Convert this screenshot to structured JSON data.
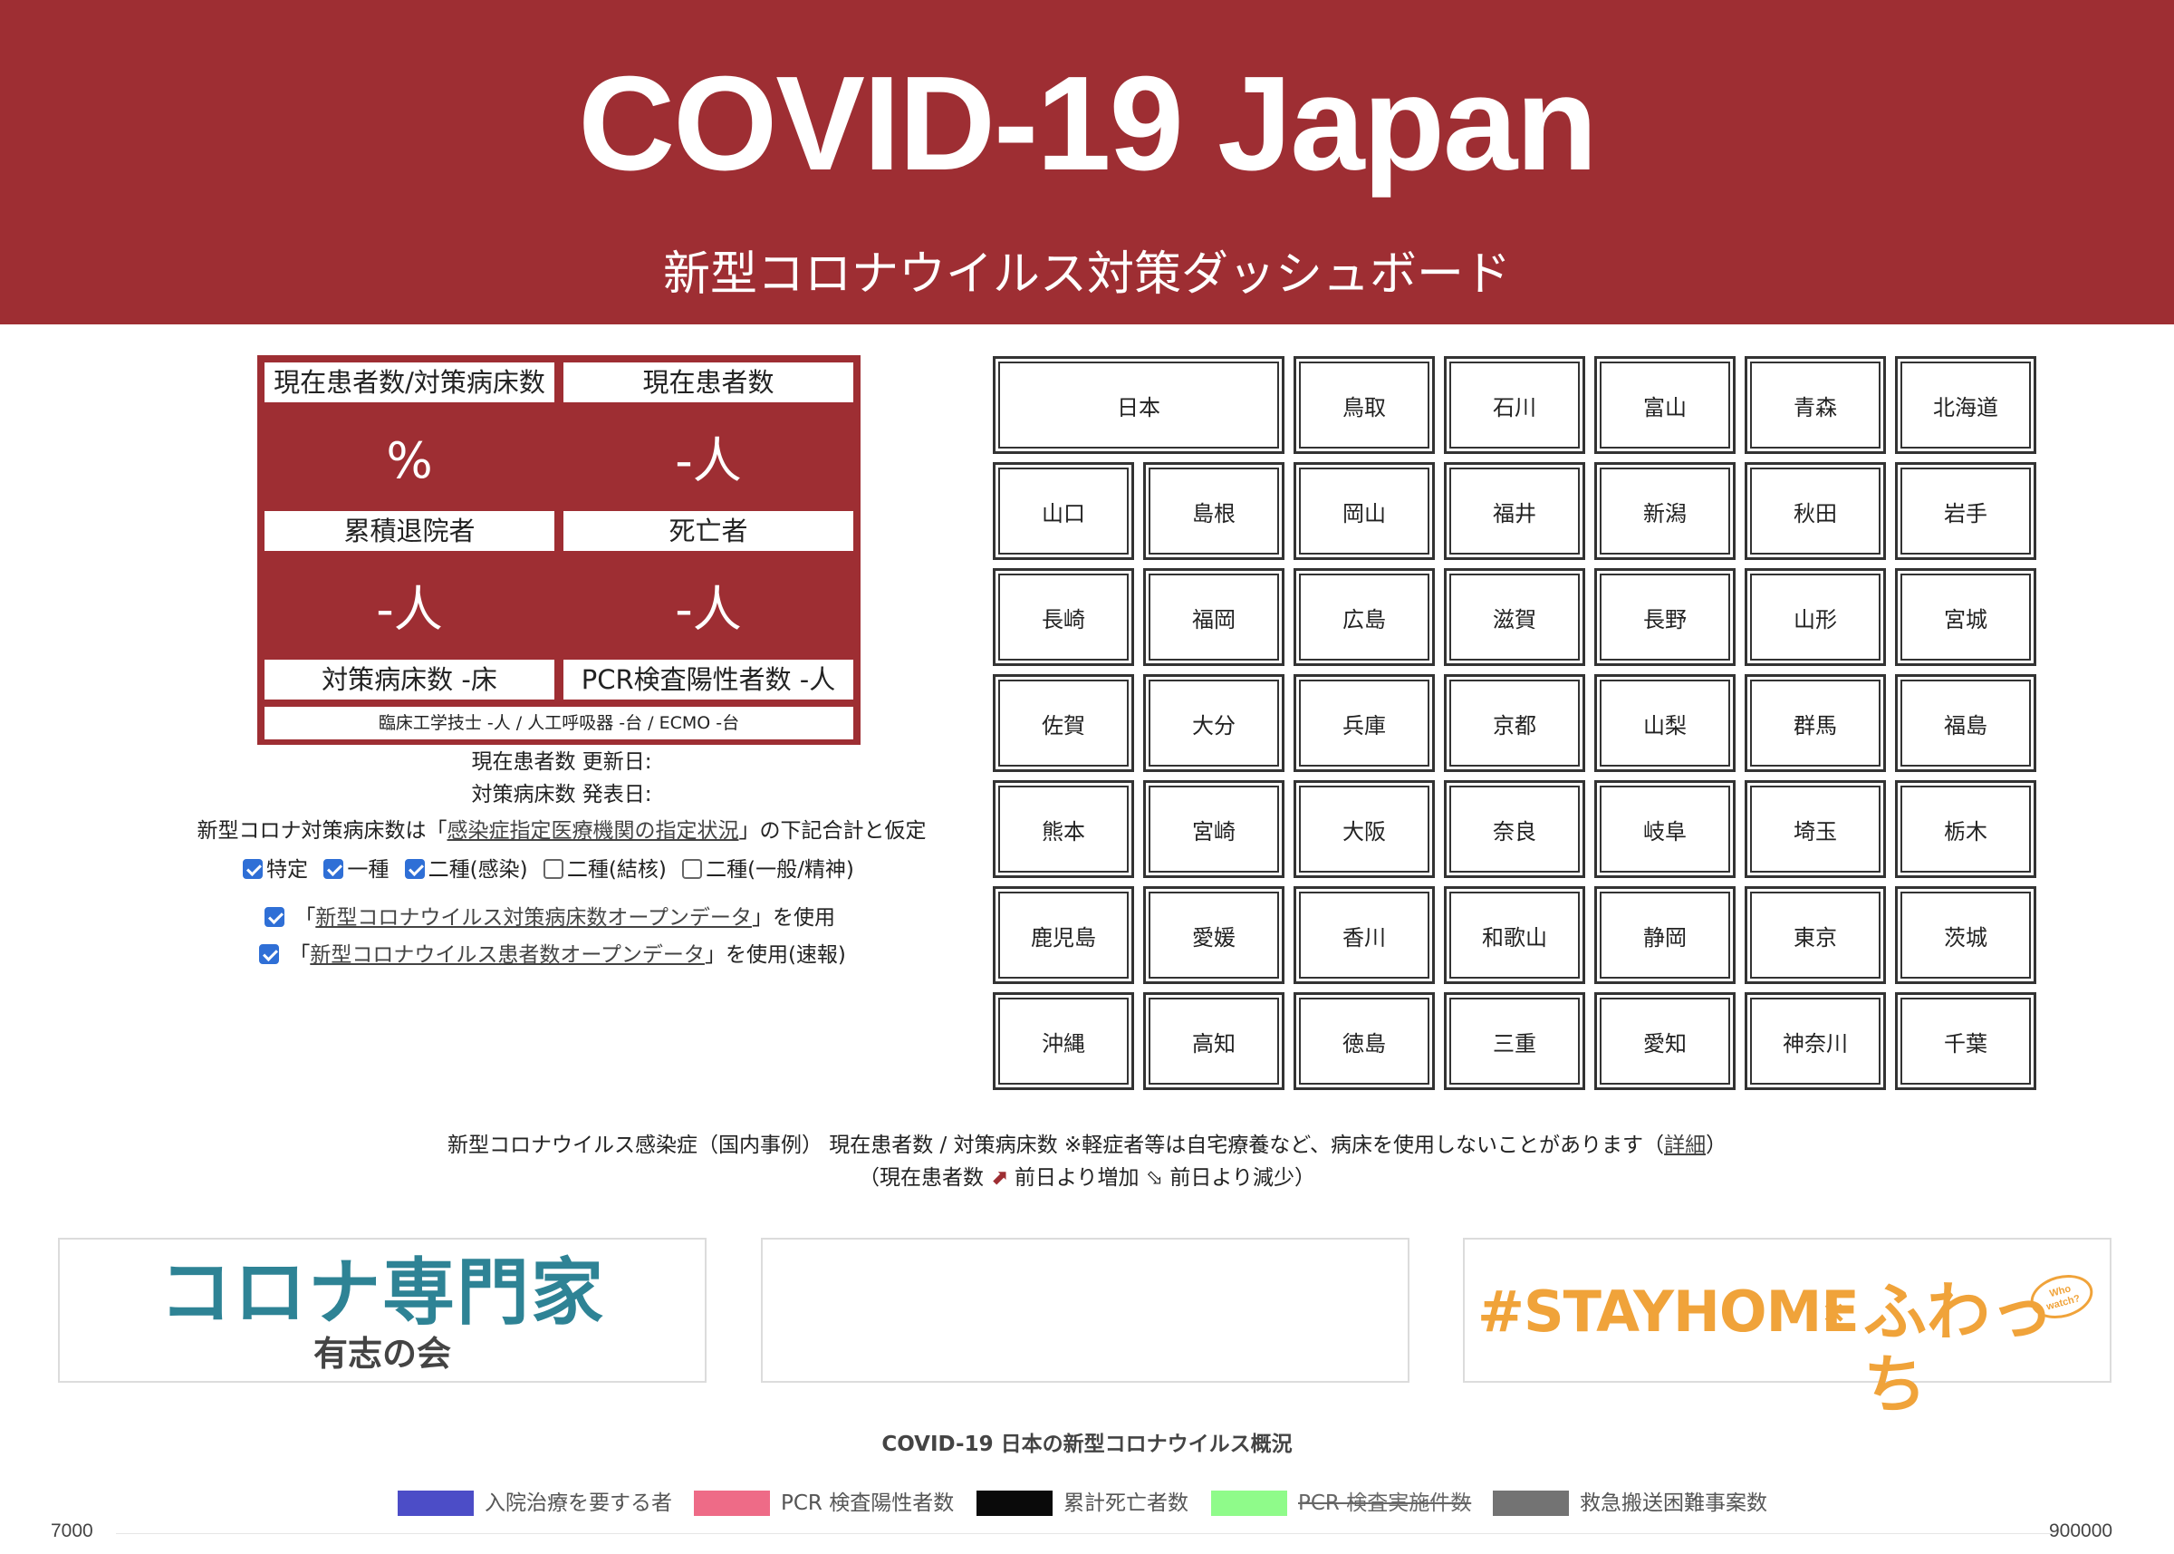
{
  "header": {
    "title": "COVID-19 Japan",
    "subtitle": "新型コロナウイルス対策ダッシュボード"
  },
  "stats": {
    "ratio_label": "現在患者数/対策病床数",
    "ratio_value": "%",
    "current_label": "現在患者数",
    "current_value": "-人",
    "discharged_label": "累積退院者",
    "discharged_value": "-人",
    "deaths_label": "死亡者",
    "deaths_value": "-人",
    "beds_label": "対策病床数 -床",
    "pcr_label": "PCR検査陽性者数 -人",
    "footer": "臨床工学技士 -人 / 人工呼吸器 -台 / ECMO -台"
  },
  "info": {
    "updated": "現在患者数 更新日:",
    "published": "対策病床数 発表日:",
    "assumption_pre": "新型コロナ対策病床数は「",
    "assumption_link": "感染症指定医療機関の指定状況",
    "assumption_post": "」の下記合計と仮定"
  },
  "filters": [
    {
      "label": "特定",
      "checked": true
    },
    {
      "label": "一種",
      "checked": true
    },
    {
      "label": "二種(感染)",
      "checked": true
    },
    {
      "label": "二種(結核)",
      "checked": false
    },
    {
      "label": "二種(一般/精神)",
      "checked": false
    }
  ],
  "opendata": [
    {
      "pre": "「",
      "link": "新型コロナウイルス対策病床数オープンデータ",
      "post": "」を使用",
      "checked": true
    },
    {
      "pre": "「",
      "link": "新型コロナウイルス患者数オープンデータ",
      "post": "」を使用(速報)",
      "checked": true
    }
  ],
  "prefectures": {
    "top_row": [
      "日本",
      "鳥取",
      "石川",
      "富山",
      "青森",
      "北海道"
    ],
    "rows": [
      [
        "山口",
        "島根",
        "岡山",
        "福井",
        "新潟",
        "秋田",
        "岩手"
      ],
      [
        "長崎",
        "福岡",
        "広島",
        "滋賀",
        "長野",
        "山形",
        "宮城"
      ],
      [
        "佐賀",
        "大分",
        "兵庫",
        "京都",
        "山梨",
        "群馬",
        "福島"
      ],
      [
        "熊本",
        "宮崎",
        "大阪",
        "奈良",
        "岐阜",
        "埼玉",
        "栃木"
      ],
      [
        "鹿児島",
        "愛媛",
        "香川",
        "和歌山",
        "静岡",
        "東京",
        "茨城"
      ],
      [
        "沖縄",
        "高知",
        "徳島",
        "三重",
        "愛知",
        "神奈川",
        "千葉"
      ]
    ]
  },
  "caption": {
    "line1_pre": "新型コロナウイルス感染症（国内事例） 現在患者数 / 対策病床数 ※軽症者等は自宅療養など、病床を使用しないことがあります（",
    "line1_link": "詳細",
    "line1_post": "）",
    "line2_pre": "（現在患者数 ",
    "line2_up": "前日より増加",
    "line2_down": "前日より減少）"
  },
  "banners": {
    "left_main": "コロナ専門家",
    "left_sub": "有志の会",
    "right_main": "#STAYHOME",
    "right_x": "×",
    "right_logo": "ふわっち",
    "right_tag": "Who watch?"
  },
  "chart": {
    "title": "COVID-19 日本の新型コロナウイルス概況",
    "legend": [
      {
        "label": "入院治療を要する者",
        "color": "#4c4dc7",
        "hidden": false
      },
      {
        "label": "PCR 検査陽性者数",
        "color": "#ee6b87",
        "hidden": false
      },
      {
        "label": "累計死亡者数",
        "color": "#0a0a0a",
        "hidden": false
      },
      {
        "label": "PCR 検査実施件数",
        "color": "#8ffb8a",
        "hidden": true
      },
      {
        "label": "救急搬送困難事案数",
        "color": "#737373",
        "hidden": false
      }
    ],
    "y_left_max": "7000",
    "y_right_max": "900000"
  },
  "colors": {
    "brand": "#9e2e33",
    "banner_teal": "#2e8395",
    "banner_orange": "#f0a33a"
  }
}
